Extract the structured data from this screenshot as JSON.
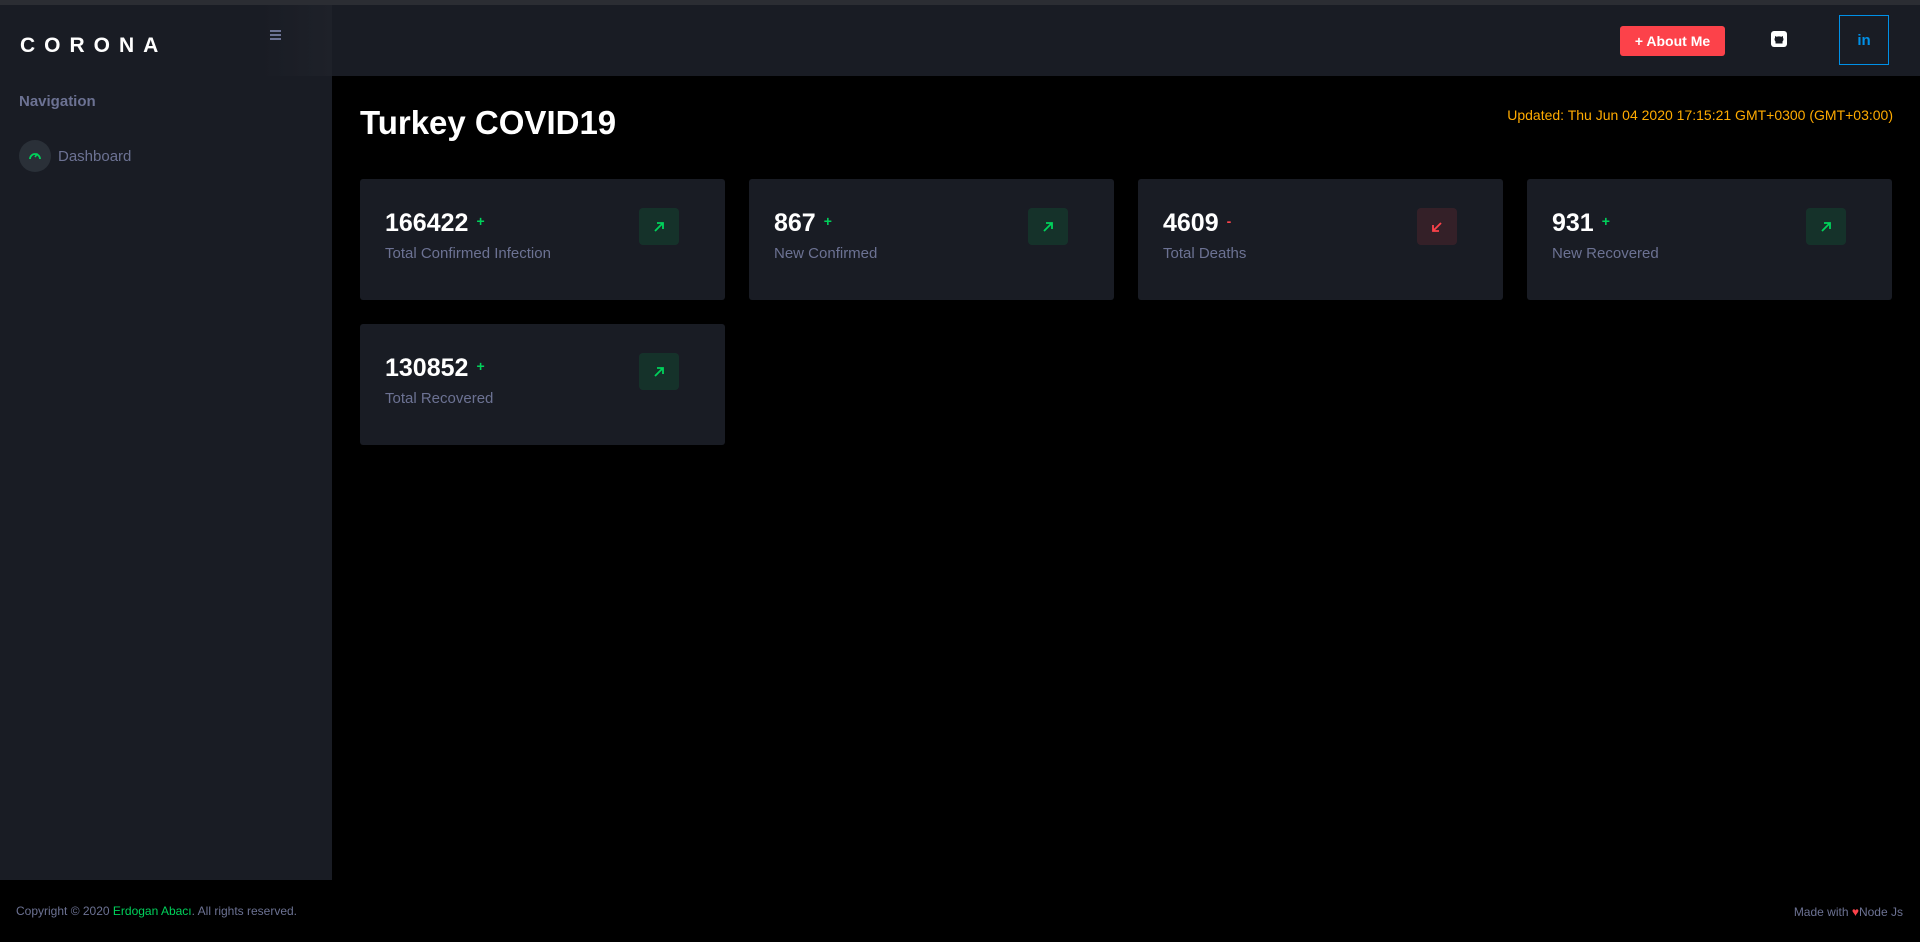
{
  "brand": "CORONA",
  "sidebar": {
    "heading": "Navigation",
    "items": [
      {
        "label": "Dashboard",
        "icon": "speedometer-icon"
      }
    ]
  },
  "header": {
    "about_label": "+ About Me",
    "github_icon": "github-icon",
    "linkedin_label": "in"
  },
  "page": {
    "title": "Turkey COVID19",
    "updated": "Updated: Thu Jun 04 2020 17:15:21 GMT+0300 (GMT+03:00)"
  },
  "stats": [
    {
      "value": "166422",
      "sign": "+",
      "label": "Total Confirmed Infection",
      "trend": "up"
    },
    {
      "value": "867",
      "sign": "+",
      "label": "New Confirmed",
      "trend": "up"
    },
    {
      "value": "4609",
      "sign": "-",
      "label": "Total Deaths",
      "trend": "down"
    },
    {
      "value": "931",
      "sign": "+",
      "label": "New Recovered",
      "trend": "up"
    },
    {
      "value": "130852",
      "sign": "+",
      "label": "Total Recovered",
      "trend": "up"
    }
  ],
  "footer": {
    "copyright_prefix": "Copyright © 2020 ",
    "author": "Erdogan Abacı",
    "copyright_suffix": ". All rights reserved.",
    "made_with_prefix": "Made with ",
    "heart": "♥",
    "made_with_suffix": "Node Js"
  },
  "colors": {
    "accent_success": "#00d25b",
    "accent_danger": "#fc424a",
    "accent_warning": "#ffab00",
    "accent_info": "#0090e7",
    "panel": "#191c24",
    "muted_text": "#6c7293"
  }
}
